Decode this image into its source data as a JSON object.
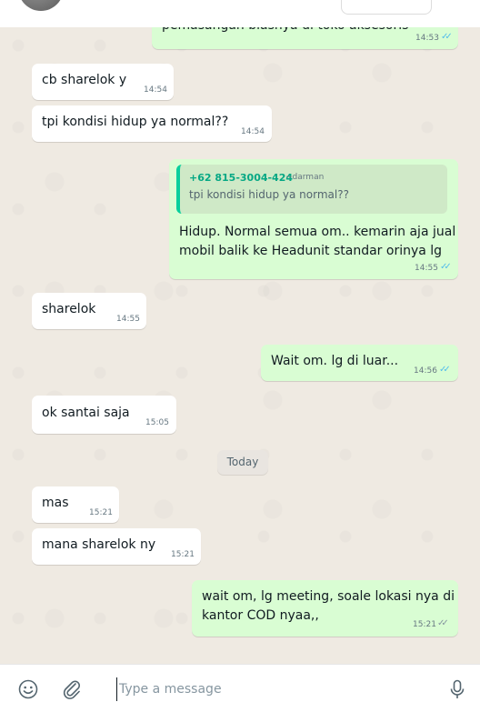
{
  "composer": {
    "placeholder": "Type a message",
    "emoji_icon": "emoji-icon",
    "attach_icon": "paperclip-icon",
    "mic_icon": "microphone-icon"
  },
  "colors": {
    "incoming_bubble": "#ffffff",
    "outgoing_bubble": "#d9fdd3",
    "read_tick": "#53bdeb",
    "chat_background": "#efeae2",
    "quote_accent": "#06cf9c"
  },
  "messages": [
    {
      "direction": "out",
      "text": "pemasangan biasnya di toko aksesoris",
      "time": "14:53",
      "status": "read"
    },
    {
      "direction": "in",
      "text": "cb sharelok y",
      "time": "14:54"
    },
    {
      "direction": "in",
      "text": "tpi kondisi hidup ya normal??",
      "time": "14:54"
    },
    {
      "direction": "out",
      "quote": {
        "sender_phone": "+62 815-3004-424",
        "sender_name": "~darman",
        "text": "tpi kondisi hidup ya normal??"
      },
      "lines": [
        "Hidup. Normal semua om.. kemarin aja jual",
        "mobil balik ke Headunit standar orinya lg"
      ],
      "time": "14:55",
      "status": "read"
    },
    {
      "direction": "in",
      "text": "sharelok",
      "time": "14:55"
    },
    {
      "direction": "out",
      "text": "Wait om. lg di luar...",
      "time": "14:56",
      "status": "read"
    },
    {
      "direction": "in",
      "text": "ok santai saja",
      "time": "15:05"
    },
    {
      "divider": "Today"
    },
    {
      "direction": "in",
      "text": "mas",
      "time": "15:21"
    },
    {
      "direction": "in",
      "text": "mana sharelok ny",
      "time": "15:21"
    },
    {
      "direction": "out",
      "lines": [
        "wait om, lg meeting, soale lokasi nya di",
        "kantor COD nyaa,,"
      ],
      "time": "15:21",
      "status": "sent"
    }
  ]
}
